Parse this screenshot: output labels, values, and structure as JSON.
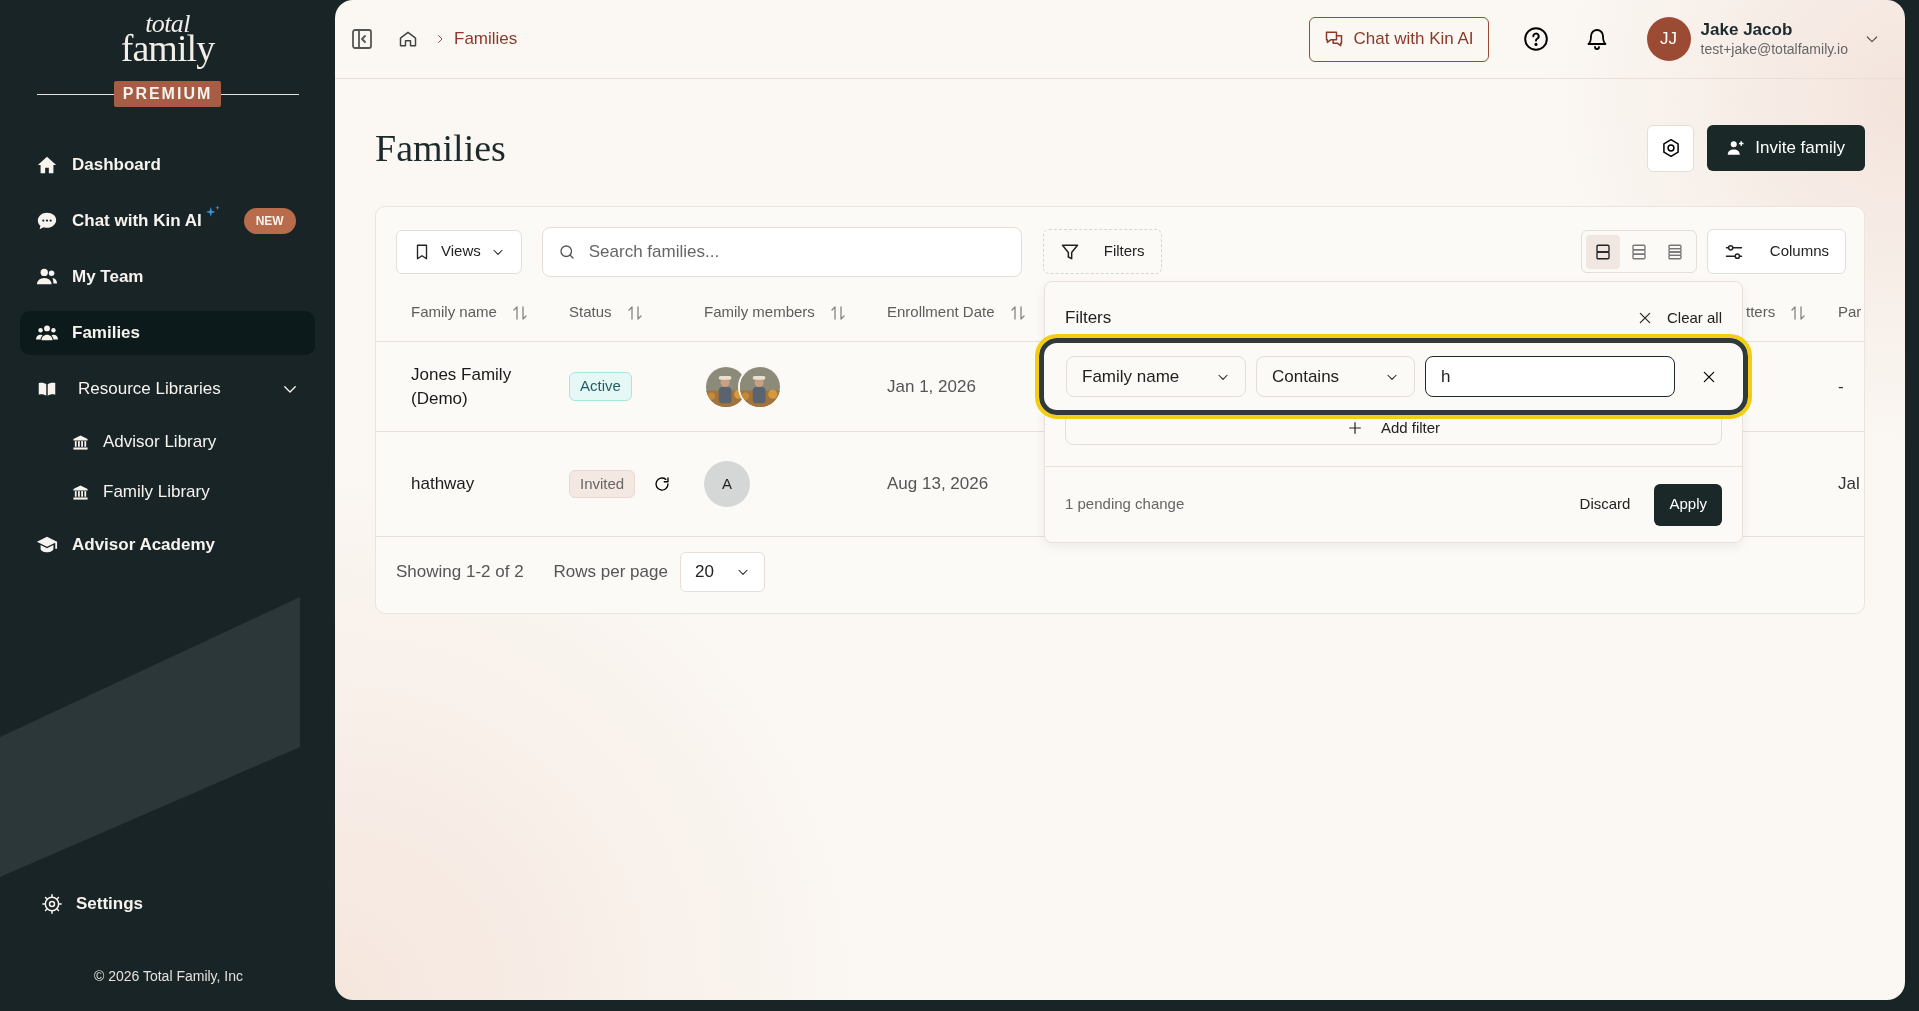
{
  "sidebar": {
    "logo": [
      "total",
      "family"
    ],
    "plan_badge": "PREMIUM",
    "items": [
      {
        "label": "Dashboard",
        "selected": false
      },
      {
        "label": "Chat with Kin AI",
        "selected": false,
        "badge": "NEW"
      },
      {
        "label": "My Team",
        "selected": false
      },
      {
        "label": "Families",
        "selected": true
      },
      {
        "label": "Resource Libraries",
        "selected": false,
        "expanded": true,
        "children": [
          {
            "label": "Advisor Library",
            "selected": false
          },
          {
            "label": "Family Library",
            "selected": false
          }
        ]
      },
      {
        "label": "Advisor Academy",
        "selected": false
      }
    ],
    "footer_item": "Settings",
    "copyright": "© 2026 Total Family, Inc"
  },
  "header": {
    "breadcrumb": [
      "Families"
    ],
    "chat_button": "Chat with Kin AI",
    "user": {
      "initials": "JJ",
      "name": "Jake Jacob",
      "email": "test+jake@totalfamily.io"
    }
  },
  "page": {
    "title": "Families",
    "invite_button": "Invite family"
  },
  "toolbar": {
    "views_button": "Views",
    "search": {
      "placeholder": "Search families..."
    },
    "filters_button": "Filters",
    "density_options": [
      {
        "selected": true
      },
      {
        "selected": false
      },
      {
        "selected": false
      }
    ],
    "columns_button": "Columns"
  },
  "table": {
    "columns": [
      {
        "label": "Family name",
        "sortable": true
      },
      {
        "label": "Status",
        "sortable": true
      },
      {
        "label": "Family members",
        "sortable": true
      },
      {
        "label": "Enrollment Date",
        "sortable": true
      },
      {
        "label": "tters",
        "sortable": true
      },
      {
        "label": "Par",
        "sortable": false
      }
    ],
    "rows": [
      {
        "family_name": "Jones Family (Demo)",
        "status": {
          "label": "Active",
          "kind": "active"
        },
        "enrollment_date": "Jan 1, 2026",
        "column_6": "-"
      },
      {
        "family_name": "hathway",
        "status": {
          "label": "Invited",
          "kind": "invited"
        },
        "members": [
          {
            "kind": "initial",
            "initial": "A"
          }
        ],
        "enrollment_date": "Aug 13, 2026",
        "column_6": "Jal"
      }
    ]
  },
  "pagination": {
    "showing": "Showing 1-2 of 2",
    "rows_per_page_label": "Rows per page",
    "rows_per_page": "20"
  },
  "filter_panel": {
    "title": "Filters",
    "clear_all": "Clear all",
    "filters": [
      {
        "field": "Family name",
        "operator": "Contains",
        "value": "h",
        "highlighted": true
      }
    ],
    "add_filter": "Add filter",
    "pending": "1 pending change",
    "discard": "Discard",
    "apply": "Apply"
  }
}
